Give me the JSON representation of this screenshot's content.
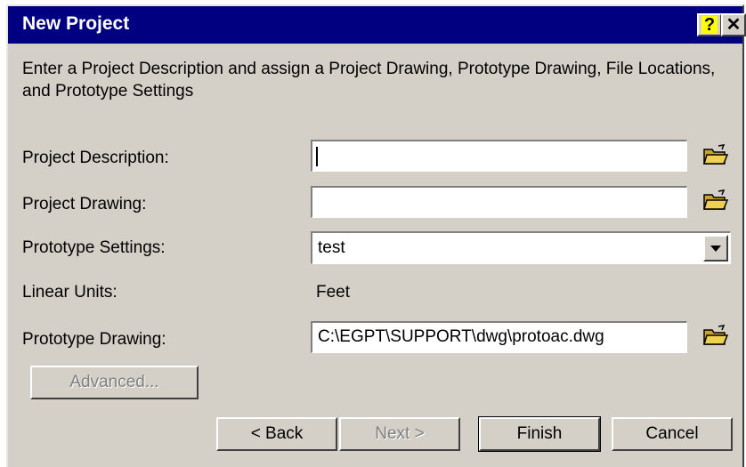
{
  "window": {
    "title": "New Project",
    "help_glyph": "?",
    "close_glyph": "✕"
  },
  "description": "Enter a Project Description and assign a Project Drawing, Prototype Drawing, File Locations, and Prototype Settings",
  "fields": {
    "project_description": {
      "label": "Project Description:",
      "value": ""
    },
    "project_drawing": {
      "label": "Project Drawing:",
      "value": ""
    },
    "prototype_settings": {
      "label": "Prototype Settings:",
      "value": "test"
    },
    "linear_units": {
      "label": "Linear Units:",
      "value": "Feet"
    },
    "prototype_drawing": {
      "label": "Prototype Drawing:",
      "value": "C:\\EGPT\\SUPPORT\\dwg\\protoac.dwg"
    }
  },
  "buttons": {
    "advanced": "Advanced...",
    "back": "< Back",
    "next": "Next >",
    "finish": "Finish",
    "cancel": "Cancel"
  },
  "colors": {
    "titlebar": "#000080",
    "dialog_bg": "#d4d0c8",
    "folder_icon": "#e8c63a"
  }
}
